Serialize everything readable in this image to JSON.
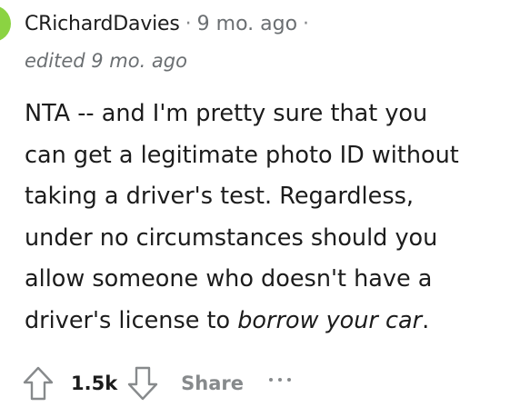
{
  "comment": {
    "username": "CRichardDavies",
    "timestamp": "9 mo. ago",
    "separator": "·",
    "edited": "edited 9 mo. ago",
    "avatar_color": "#8bd342",
    "body": {
      "line1": "NTA -- and I'm pretty sure that you",
      "line2": "can get a legitimate photo ID without",
      "line3": "taking a driver's test. Regardless,",
      "line4": "under no circumstances should you",
      "line5": "allow someone who doesn't have a",
      "line6_plain": "driver's license to ",
      "line6_italic": "borrow your car",
      "line6_end": "."
    }
  },
  "actions": {
    "score": "1.5k",
    "share_label": "Share",
    "upvote_icon": "upvote-arrow-icon",
    "downvote_icon": "downvote-arrow-icon",
    "more_icon": "more-options-icon"
  }
}
